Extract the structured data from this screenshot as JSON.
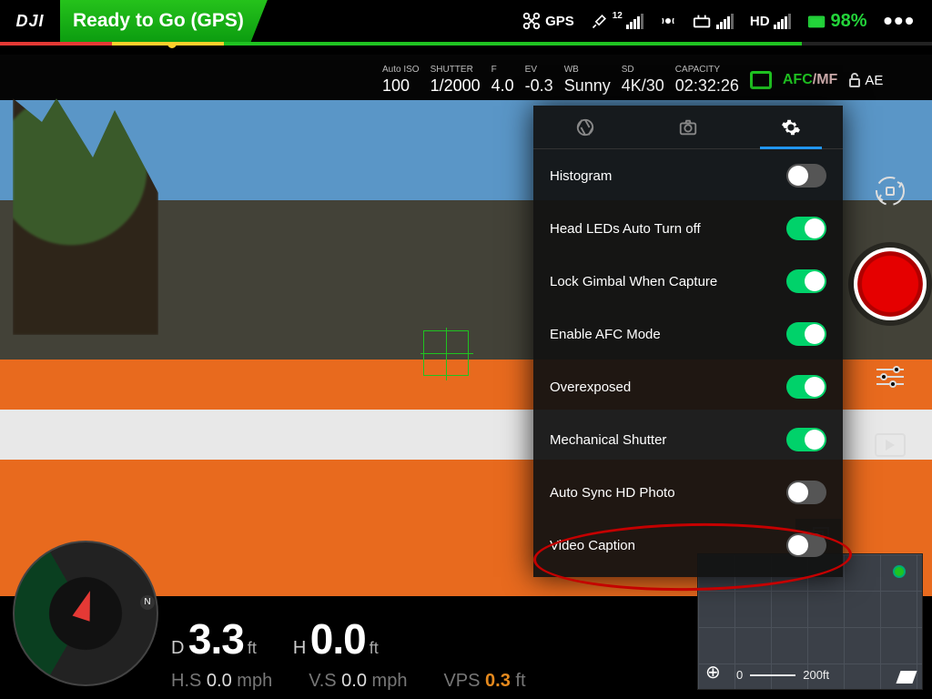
{
  "brand": "DJI",
  "status_text": "Ready to Go (GPS)",
  "top": {
    "mode": "GPS",
    "sat_count": "12",
    "hd_label": "HD",
    "battery_pct": "98%"
  },
  "params": {
    "iso_label": "Auto ISO",
    "iso": "100",
    "shutter_label": "SHUTTER",
    "shutter": "1/2000",
    "f_label": "F",
    "f": "4.0",
    "ev_label": "EV",
    "ev": "-0.3",
    "wb_label": "WB",
    "wb": "Sunny",
    "sd_label": "SD",
    "sd": "4K/30",
    "cap_label": "CAPACITY",
    "cap": "02:32:26",
    "afc": "AFC",
    "mf": "/MF",
    "ae": "AE"
  },
  "settings": {
    "items": [
      {
        "label": "Histogram",
        "on": false
      },
      {
        "label": "Head LEDs Auto Turn off",
        "on": true
      },
      {
        "label": "Lock Gimbal When Capture",
        "on": true
      },
      {
        "label": "Enable AFC Mode",
        "on": true
      },
      {
        "label": "Overexposed",
        "on": true
      },
      {
        "label": "Mechanical Shutter",
        "on": true
      },
      {
        "label": "Auto Sync HD Photo",
        "on": false
      },
      {
        "label": "Video Caption",
        "on": false
      }
    ]
  },
  "telemetry": {
    "d_label": "D",
    "d": "3.3",
    "d_unit": "ft",
    "h_label": "H",
    "h": "0.0",
    "h_unit": "ft",
    "hs_label": "H.S",
    "hs": "0.0",
    "hs_unit": "mph",
    "vs_label": "V.S",
    "vs": "0.0",
    "vs_unit": "mph",
    "vps_label": "VPS",
    "vps": "0.3",
    "vps_unit": "ft"
  },
  "compass": {
    "n": "N"
  },
  "minimap": {
    "scale_a": "0",
    "scale_b": "200ft"
  }
}
